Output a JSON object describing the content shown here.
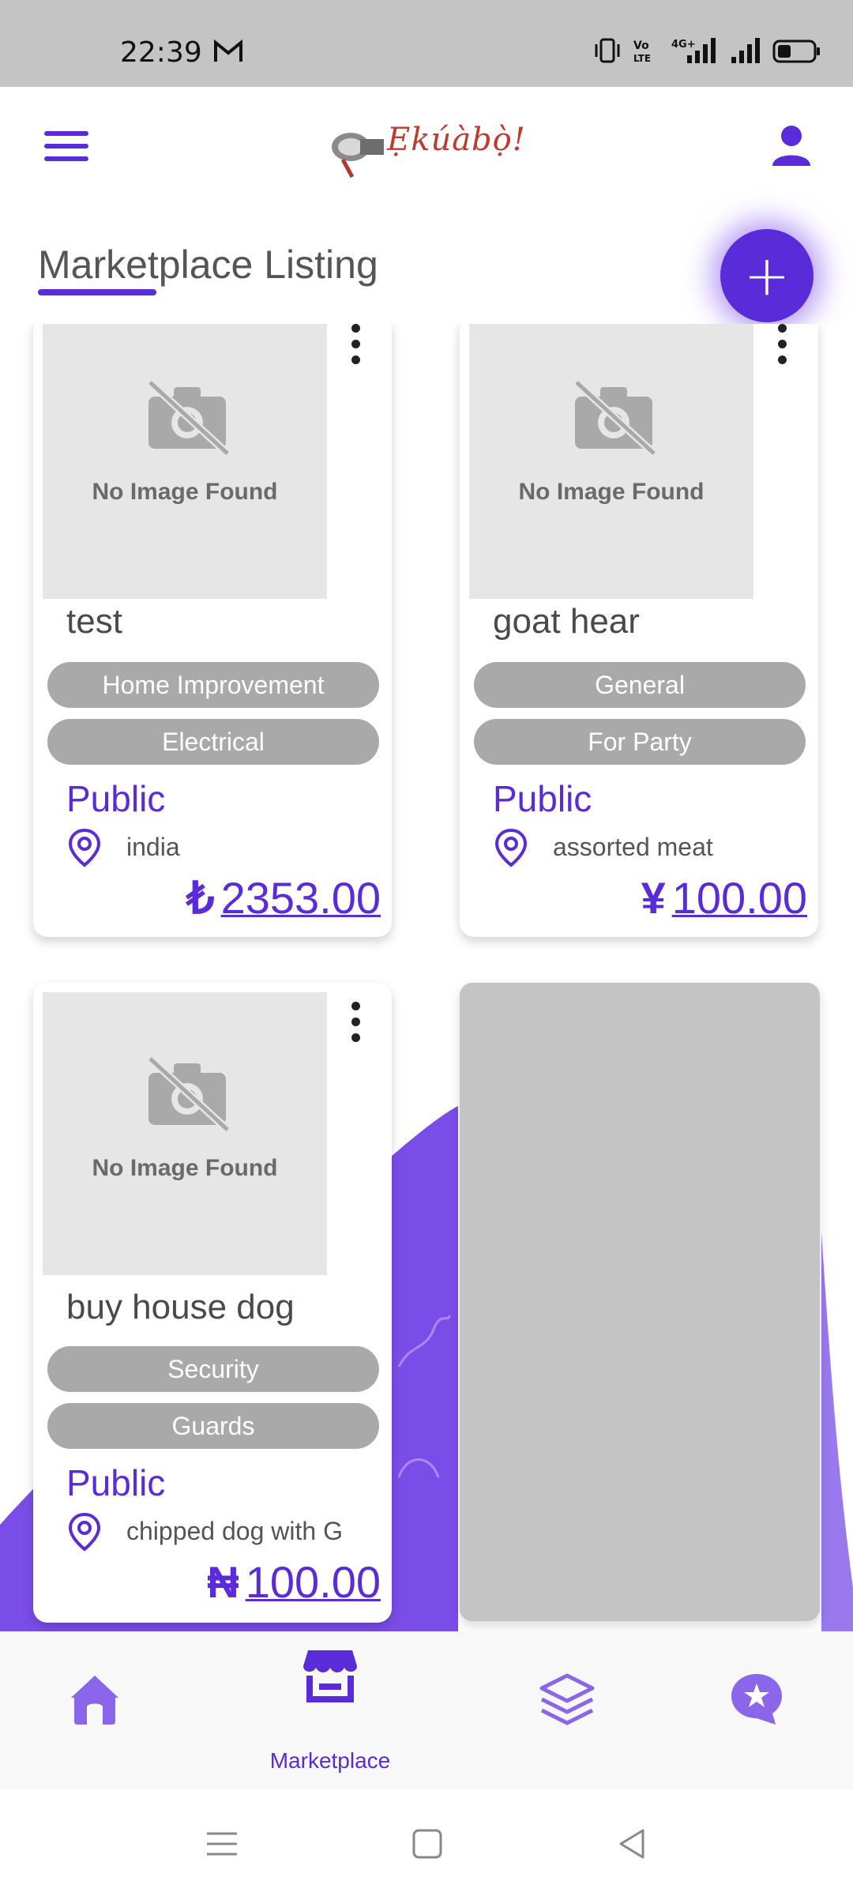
{
  "status_bar": {
    "time": "22:39",
    "icons": [
      "gmail-icon",
      "vibrate-icon",
      "volte-icon",
      "signal-4g-icon",
      "signal-icon",
      "battery-icon"
    ]
  },
  "header": {
    "logo_text": "Ẹkúàbọ̀!",
    "menu_icon": "hamburger-icon",
    "profile_icon": "user-icon"
  },
  "page": {
    "title": "Marketplace Listing",
    "fab_label": "+"
  },
  "cards": [
    {
      "no_image_text": "No Image Found",
      "name": "test",
      "chips": [
        "Home Improvement",
        "Electrical"
      ],
      "visibility": "Public",
      "location": "india",
      "currency": "₺",
      "price": "2353.00"
    },
    {
      "no_image_text": "No Image Found",
      "name": "goat hear",
      "chips": [
        "General",
        "For Party"
      ],
      "visibility": "Public",
      "location": "assorted meat",
      "currency": "¥",
      "price": "100.00"
    },
    {
      "no_image_text": "No Image Found",
      "name": "buy house dog",
      "chips": [
        "Security",
        "Guards"
      ],
      "visibility": "Public",
      "location": "chipped dog with G",
      "currency": "₦",
      "price": "100.00"
    }
  ],
  "bottom_nav": {
    "items": [
      {
        "icon": "home-icon",
        "label": ""
      },
      {
        "icon": "store-icon",
        "label": "Marketplace"
      },
      {
        "icon": "layers-icon",
        "label": ""
      },
      {
        "icon": "star-chat-icon",
        "label": ""
      }
    ]
  },
  "colors": {
    "accent": "#5a2bd8",
    "chip": "#a9a9a9",
    "placeholder": "#c4c4c4",
    "wave": "#7b4de8"
  }
}
